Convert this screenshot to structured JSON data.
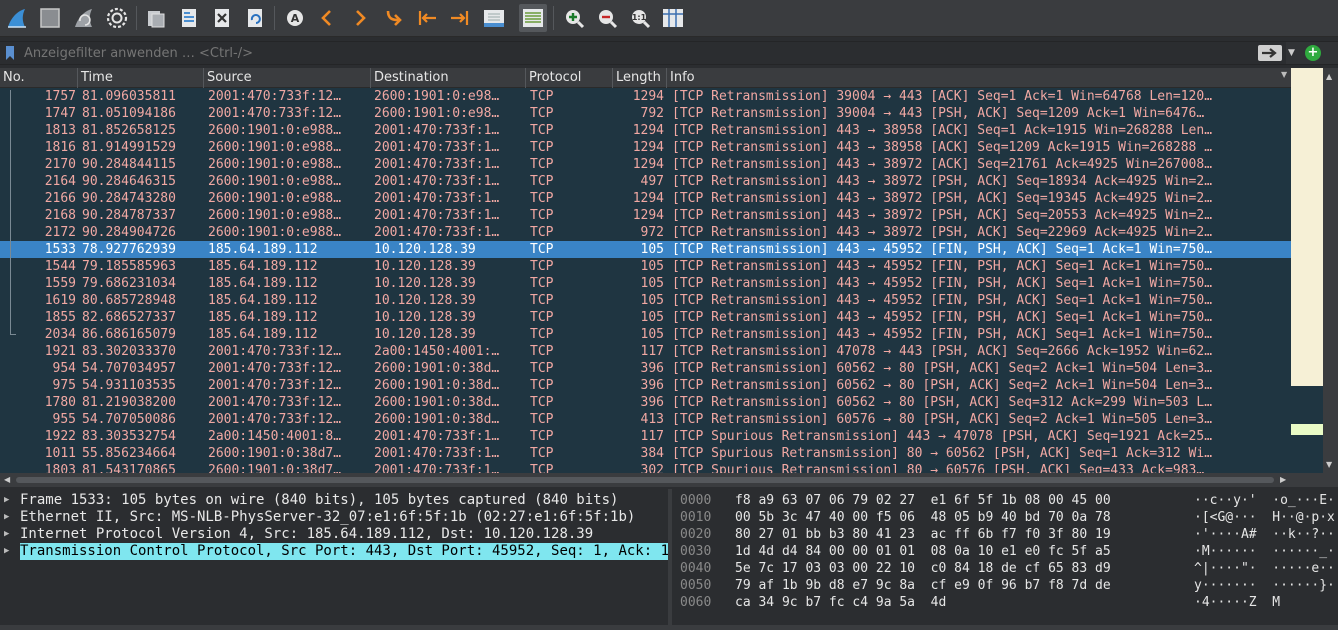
{
  "toolbar": {
    "icons": [
      "shark-fin-start-icon",
      "stop-icon",
      "restart-icon",
      "options-gear-icon",
      "open-folder-icon",
      "save-file-icon",
      "close-file-icon",
      "reload-icon",
      "find-icon",
      "back-arrow-icon",
      "forward-arrow-icon",
      "goto-icon",
      "first-packet-icon",
      "last-packet-icon",
      "autoscroll-icon",
      "colorize-icon",
      "zoom-in-icon",
      "zoom-out-icon",
      "zoom-normal-icon",
      "resize-columns-icon"
    ]
  },
  "filter": {
    "placeholder": "Anzeigefilter anwenden … <Ctrl-/>",
    "add_label": "+"
  },
  "columns": [
    "No.",
    "Time",
    "Source",
    "Destination",
    "Protocol",
    "Length",
    "Info"
  ],
  "packets": [
    {
      "no": "1757",
      "time": "81.096035811",
      "src": "2001:470:733f:12…",
      "dst": "2600:1901:0:e98…",
      "proto": "TCP",
      "len": "1294",
      "info": "[TCP Retransmission] 39004 → 443 [ACK] Seq=1 Ack=1 Win=64768 Len=120…"
    },
    {
      "no": "1747",
      "time": "81.051094186",
      "src": "2001:470:733f:12…",
      "dst": "2600:1901:0:e98…",
      "proto": "TCP",
      "len": "792",
      "info": "[TCP Retransmission] 39004 → 443 [PSH, ACK] Seq=1209 Ack=1 Win=6476…"
    },
    {
      "no": "1813",
      "time": "81.852658125",
      "src": "2600:1901:0:e988…",
      "dst": "2001:470:733f:1…",
      "proto": "TCP",
      "len": "1294",
      "info": "[TCP Retransmission] 443 → 38958 [ACK] Seq=1 Ack=1915 Win=268288 Len…"
    },
    {
      "no": "1816",
      "time": "81.914991529",
      "src": "2600:1901:0:e988…",
      "dst": "2001:470:733f:1…",
      "proto": "TCP",
      "len": "1294",
      "info": "[TCP Retransmission] 443 → 38958 [ACK] Seq=1209 Ack=1915 Win=268288 …"
    },
    {
      "no": "2170",
      "time": "90.284844115",
      "src": "2600:1901:0:e988…",
      "dst": "2001:470:733f:1…",
      "proto": "TCP",
      "len": "1294",
      "info": "[TCP Retransmission] 443 → 38972 [ACK] Seq=21761 Ack=4925 Win=267008…"
    },
    {
      "no": "2164",
      "time": "90.284646315",
      "src": "2600:1901:0:e988…",
      "dst": "2001:470:733f:1…",
      "proto": "TCP",
      "len": "497",
      "info": "[TCP Retransmission] 443 → 38972 [PSH, ACK] Seq=18934 Ack=4925 Win=2…"
    },
    {
      "no": "2166",
      "time": "90.284743280",
      "src": "2600:1901:0:e988…",
      "dst": "2001:470:733f:1…",
      "proto": "TCP",
      "len": "1294",
      "info": "[TCP Retransmission] 443 → 38972 [PSH, ACK] Seq=19345 Ack=4925 Win=2…"
    },
    {
      "no": "2168",
      "time": "90.284787337",
      "src": "2600:1901:0:e988…",
      "dst": "2001:470:733f:1…",
      "proto": "TCP",
      "len": "1294",
      "info": "[TCP Retransmission] 443 → 38972 [PSH, ACK] Seq=20553 Ack=4925 Win=2…"
    },
    {
      "no": "2172",
      "time": "90.284904726",
      "src": "2600:1901:0:e988…",
      "dst": "2001:470:733f:1…",
      "proto": "TCP",
      "len": "972",
      "info": "[TCP Retransmission] 443 → 38972 [PSH, ACK] Seq=22969 Ack=4925 Win=2…"
    },
    {
      "no": "1533",
      "time": "78.927762939",
      "src": "185.64.189.112",
      "dst": "10.120.128.39",
      "proto": "TCP",
      "len": "105",
      "info": "[TCP Retransmission] 443 → 45952 [FIN, PSH, ACK] Seq=1 Ack=1 Win=750…",
      "selected": true
    },
    {
      "no": "1544",
      "time": "79.185585963",
      "src": "185.64.189.112",
      "dst": "10.120.128.39",
      "proto": "TCP",
      "len": "105",
      "info": "[TCP Retransmission] 443 → 45952 [FIN, PSH, ACK] Seq=1 Ack=1 Win=750…"
    },
    {
      "no": "1559",
      "time": "79.686231034",
      "src": "185.64.189.112",
      "dst": "10.120.128.39",
      "proto": "TCP",
      "len": "105",
      "info": "[TCP Retransmission] 443 → 45952 [FIN, PSH, ACK] Seq=1 Ack=1 Win=750…"
    },
    {
      "no": "1619",
      "time": "80.685728948",
      "src": "185.64.189.112",
      "dst": "10.120.128.39",
      "proto": "TCP",
      "len": "105",
      "info": "[TCP Retransmission] 443 → 45952 [FIN, PSH, ACK] Seq=1 Ack=1 Win=750…"
    },
    {
      "no": "1855",
      "time": "82.686527337",
      "src": "185.64.189.112",
      "dst": "10.120.128.39",
      "proto": "TCP",
      "len": "105",
      "info": "[TCP Retransmission] 443 → 45952 [FIN, PSH, ACK] Seq=1 Ack=1 Win=750…"
    },
    {
      "no": "2034",
      "time": "86.686165079",
      "src": "185.64.189.112",
      "dst": "10.120.128.39",
      "proto": "TCP",
      "len": "105",
      "info": "[TCP Retransmission] 443 → 45952 [FIN, PSH, ACK] Seq=1 Ack=1 Win=750…"
    },
    {
      "no": "1921",
      "time": "83.302033370",
      "src": "2001:470:733f:12…",
      "dst": "2a00:1450:4001:…",
      "proto": "TCP",
      "len": "117",
      "info": "[TCP Retransmission] 47078 → 443 [PSH, ACK] Seq=2666 Ack=1952 Win=62…"
    },
    {
      "no": "954",
      "time": "54.707034957",
      "src": "2001:470:733f:12…",
      "dst": "2600:1901:0:38d…",
      "proto": "TCP",
      "len": "396",
      "info": "[TCP Retransmission] 60562 → 80 [PSH, ACK] Seq=2 Ack=1 Win=504 Len=3…"
    },
    {
      "no": "975",
      "time": "54.931103535",
      "src": "2001:470:733f:12…",
      "dst": "2600:1901:0:38d…",
      "proto": "TCP",
      "len": "396",
      "info": "[TCP Retransmission] 60562 → 80 [PSH, ACK] Seq=2 Ack=1 Win=504 Len=3…"
    },
    {
      "no": "1780",
      "time": "81.219038200",
      "src": "2001:470:733f:12…",
      "dst": "2600:1901:0:38d…",
      "proto": "TCP",
      "len": "396",
      "info": "[TCP Retransmission] 60562 → 80 [PSH, ACK] Seq=312 Ack=299 Win=503 L…"
    },
    {
      "no": "955",
      "time": "54.707050086",
      "src": "2001:470:733f:12…",
      "dst": "2600:1901:0:38d…",
      "proto": "TCP",
      "len": "413",
      "info": "[TCP Retransmission] 60576 → 80 [PSH, ACK] Seq=2 Ack=1 Win=505 Len=3…"
    },
    {
      "no": "1922",
      "time": "83.303532754",
      "src": "2a00:1450:4001:8…",
      "dst": "2001:470:733f:1…",
      "proto": "TCP",
      "len": "117",
      "info": "[TCP Spurious Retransmission] 443 → 47078 [PSH, ACK] Seq=1921 Ack=25…"
    },
    {
      "no": "1011",
      "time": "55.856234664",
      "src": "2600:1901:0:38d7…",
      "dst": "2001:470:733f:1…",
      "proto": "TCP",
      "len": "384",
      "info": "[TCP Spurious Retransmission] 80 → 60562 [PSH, ACK] Seq=1 Ack=312 Wi…"
    },
    {
      "no": "1803",
      "time": "81.543170865",
      "src": "2600:1901:0:38d7…",
      "dst": "2001:470:733f:1…",
      "proto": "TCP",
      "len": "302",
      "info": "[TCP Spurious Retransmission] 80 → 60576 [PSH, ACK] Seq=433 Ack=983…"
    }
  ],
  "details": [
    {
      "text": "Frame 1533: 105 bytes on wire (840 bits), 105 bytes captured (840 bits)",
      "selected": false
    },
    {
      "text": "Ethernet II, Src: MS-NLB-PhysServer-32_07:e1:6f:5f:1b (02:27:e1:6f:5f:1b)",
      "selected": false
    },
    {
      "text": "Internet Protocol Version 4, Src: 185.64.189.112, Dst: 10.120.128.39",
      "selected": false
    },
    {
      "text": "Transmission Control Protocol, Src Port: 443, Dst Port: 45952, Seq: 1, Ack: 1",
      "selected": true
    }
  ],
  "bytes": [
    {
      "offset": "0000",
      "hex": "f8 a9 63 07 06 79 02 27  e1 6f 5f 1b 08 00 45 00",
      "ascii": "··c··y·'  ·o_···E·"
    },
    {
      "offset": "0010",
      "hex": "00 5b 3c 47 40 00 f5 06  48 05 b9 40 bd 70 0a 78",
      "ascii": "·[<G@···  H··@·p·x"
    },
    {
      "offset": "0020",
      "hex": "80 27 01 bb b3 80 41 23  ac ff 6b f7 f0 3f 80 19",
      "ascii": "·'····A#  ··k··?··"
    },
    {
      "offset": "0030",
      "hex": "1d 4d d4 84 00 00 01 01  08 0a 10 e1 e0 fc 5f a5",
      "ascii": "·M······  ······_·"
    },
    {
      "offset": "0040",
      "hex": "5e 7c 17 03 03 00 22 10  c0 84 18 de cf 65 83 d9",
      "ascii": "^|····\"·  ·····e··"
    },
    {
      "offset": "0050",
      "hex": "79 af 1b 9b d8 e7 9c 8a  cf e9 0f 96 b7 f8 7d de",
      "ascii": "y·······  ······}·"
    },
    {
      "offset": "0060",
      "hex": "ca 34 9c b7 fc c4 9a 5a  4d",
      "ascii": "·4·····Z  M"
    }
  ],
  "colors": {
    "row_bg": "#1f3541",
    "row_text": "#f1a8a3",
    "selected_bg": "#3a84c6",
    "detail_selected_bg": "#7fe6ef"
  }
}
